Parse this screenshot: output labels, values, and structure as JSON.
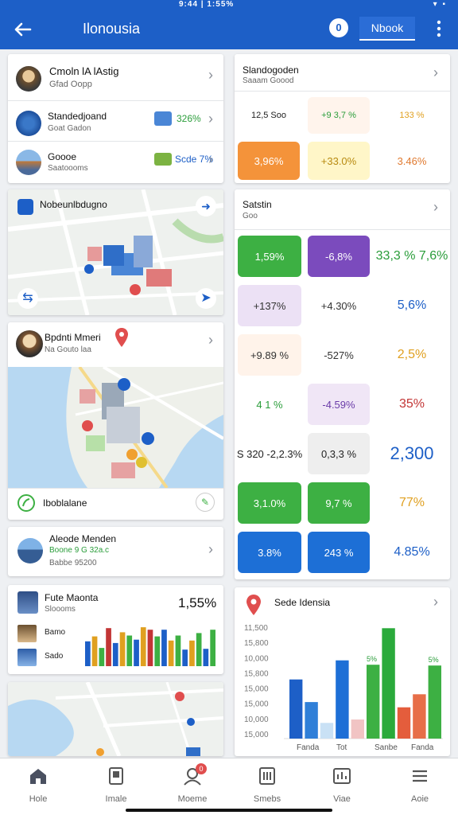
{
  "status_bar": {
    "time": "9:44 | 1:55%",
    "right_icons": [
      "wifi-icon",
      "battery-icon"
    ]
  },
  "app_bar": {
    "title": "Ilonousia",
    "badge": "0",
    "mode_button": "Nbook",
    "back_icon": "arrow-left-icon",
    "menu_icon": "kebab-icon"
  },
  "left": {
    "card1": {
      "items": [
        {
          "title": "Cmoln lA lAstig",
          "subtitle": "Gfad Oopp"
        },
        {
          "title": "Standedjoand",
          "subtitle": "Goat Gadon",
          "value": "326%"
        },
        {
          "title": "Goooe",
          "subtitle": "Saatoooms",
          "value": "Scde 7%"
        }
      ]
    },
    "map1": {
      "title": "Nobeunlbdugno"
    },
    "map2": {
      "title": "Bpdnti Mmeri",
      "subtitle": "Na Gouto laa",
      "footer": "Iboblalane"
    },
    "card_single": {
      "title": "Aleode Menden",
      "subtitle": "Boone 9 G 32a.c",
      "subtitle2": "Babbe 95200"
    },
    "chart_card": {
      "title": "Fute Maonta",
      "subtitle": "Sloooms",
      "value": "1,55%",
      "rows": [
        "Bamo",
        "Sado"
      ]
    }
  },
  "right": {
    "card1": {
      "title": "Slandogoden",
      "subtitle": "Saaam Goood",
      "row1": [
        "12,5 Soo",
        "+9 3,7 %",
        "133 %"
      ],
      "row2": [
        "3,96%",
        "+33.0%",
        "3.46%"
      ]
    },
    "card2": {
      "title": "Satstin",
      "subtitle": "Goo",
      "tiles": [
        {
          "label": "1,59%",
          "bg": "#3db043",
          "fg": "#ffffff"
        },
        {
          "label": "-6,8%",
          "bg": "#7b4bbd",
          "fg": "#ffffff"
        },
        {
          "label": "33,3 % 7,6%",
          "bg": "#ffffff",
          "fg": "#2a9d3a"
        },
        {
          "label": "+137%",
          "bg": "#ece1f5",
          "fg": "#333333"
        },
        {
          "label": "+4.30%",
          "bg": "#ffffff",
          "fg": "#333333"
        },
        {
          "label": "5,6%",
          "bg": "#ffffff",
          "fg": "#1d5fc7"
        },
        {
          "label": "+9.89 %",
          "bg": "#fff3ea",
          "fg": "#333333"
        },
        {
          "label": "-527%",
          "bg": "#ffffff",
          "fg": "#333333"
        },
        {
          "label": "2,5%",
          "bg": "#ffffff",
          "fg": "#e0a020"
        },
        {
          "label": "4 1 %",
          "bg": "#ffffff",
          "fg": "#2a9d3a"
        },
        {
          "label": "-4.59%",
          "bg": "#f0e6f6",
          "fg": "#6a3ba8"
        },
        {
          "label": "35%",
          "bg": "#ffffff",
          "fg": "#c23535"
        },
        {
          "label": "S 320 -2,2.3%",
          "bg": "#ffffff",
          "fg": "#222222"
        },
        {
          "label": "0,3,3 %",
          "bg": "#eeeeee",
          "fg": "#222222"
        },
        {
          "label": "2,300",
          "bg": "#ffffff",
          "fg": "#1d5fc7"
        },
        {
          "label": "3,1.0%",
          "bg": "#3db043",
          "fg": "#ffffff"
        },
        {
          "label": "9,7 %",
          "bg": "#3db043",
          "fg": "#ffffff"
        },
        {
          "label": "77%",
          "bg": "#ffffff",
          "fg": "#e0a020"
        },
        {
          "label": "3.8%",
          "bg": "#1d6fd6",
          "fg": "#ffffff"
        },
        {
          "label": "243 %",
          "bg": "#1d6fd6",
          "fg": "#ffffff"
        },
        {
          "label": "4.85%",
          "bg": "#ffffff",
          "fg": "#1d5fc7"
        }
      ]
    },
    "chart_card": {
      "title": "Sede Idensia",
      "pin_icon": "location-pin-icon"
    }
  },
  "chart_data": {
    "type": "bar",
    "title": "Sede Idensia",
    "y_tick_labels": [
      "11,500",
      "15,800",
      "10,000",
      "15,800",
      "15,000",
      "15,000",
      "10,000",
      "15,000"
    ],
    "categories": [
      "Fanda",
      "Tot",
      "Sanbe",
      "Fanda"
    ],
    "annotations": [
      "5%",
      "5%"
    ],
    "bars": [
      {
        "value": 68,
        "color": "#1d5fc7"
      },
      {
        "value": 42,
        "color": "#2f7fd8"
      },
      {
        "value": 18,
        "color": "#c9e1f5"
      },
      {
        "value": 90,
        "color": "#1d6fd6"
      },
      {
        "value": 22,
        "color": "#f1c4c4"
      },
      {
        "value": 85,
        "color": "#3db043"
      },
      {
        "value": 127,
        "color": "#2aaa3b"
      },
      {
        "value": 36,
        "color": "#e45d3c"
      },
      {
        "value": 51,
        "color": "#e76e48"
      },
      {
        "value": 84,
        "color": "#3db043"
      }
    ]
  },
  "mini_chart": {
    "type": "bar",
    "values": [
      30,
      36,
      22,
      46,
      28,
      41,
      37,
      32,
      47,
      44,
      36,
      44,
      31,
      37,
      20,
      31,
      40,
      21,
      44
    ],
    "colors": [
      "#1d5fc7",
      "#e0a020",
      "#3db043",
      "#c23535",
      "#1d5fc7",
      "#e0a020",
      "#3db043",
      "#1d5fc7",
      "#e0a020",
      "#c23535",
      "#3db043",
      "#1d5fc7",
      "#e0a020",
      "#3db043",
      "#1d5fc7",
      "#e0a020",
      "#3db043",
      "#1d5fc7",
      "#3db043"
    ]
  },
  "bottom_nav": {
    "items": [
      {
        "label": "Hole",
        "icon": "home-icon"
      },
      {
        "label": "Imale",
        "icon": "document-icon"
      },
      {
        "label": "Moeme",
        "icon": "profile-icon",
        "badge": "0"
      },
      {
        "label": "Smebs",
        "icon": "tablet-icon"
      },
      {
        "label": "Viae",
        "icon": "chart-icon"
      },
      {
        "label": "Aoie",
        "icon": "menu-icon"
      }
    ]
  }
}
